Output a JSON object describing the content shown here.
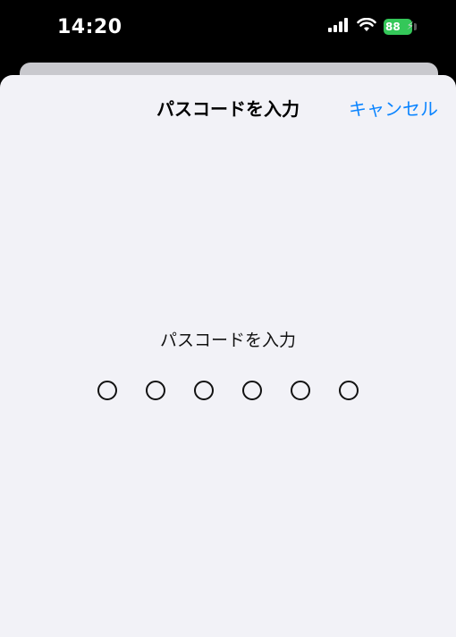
{
  "status_bar": {
    "time": "14:20",
    "battery_level": "88",
    "icons": [
      "signal-icon",
      "wifi-icon",
      "battery-icon",
      "charging-icon"
    ],
    "battery_color": "#34c759"
  },
  "sheet": {
    "title": "パスコードを入力",
    "cancel_label": "キャンセル",
    "prompt": "パスコードを入力",
    "passcode_length": 6,
    "entered_digits": 0,
    "accent_color": "#0a84ff",
    "background_color": "#f2f2f7"
  }
}
